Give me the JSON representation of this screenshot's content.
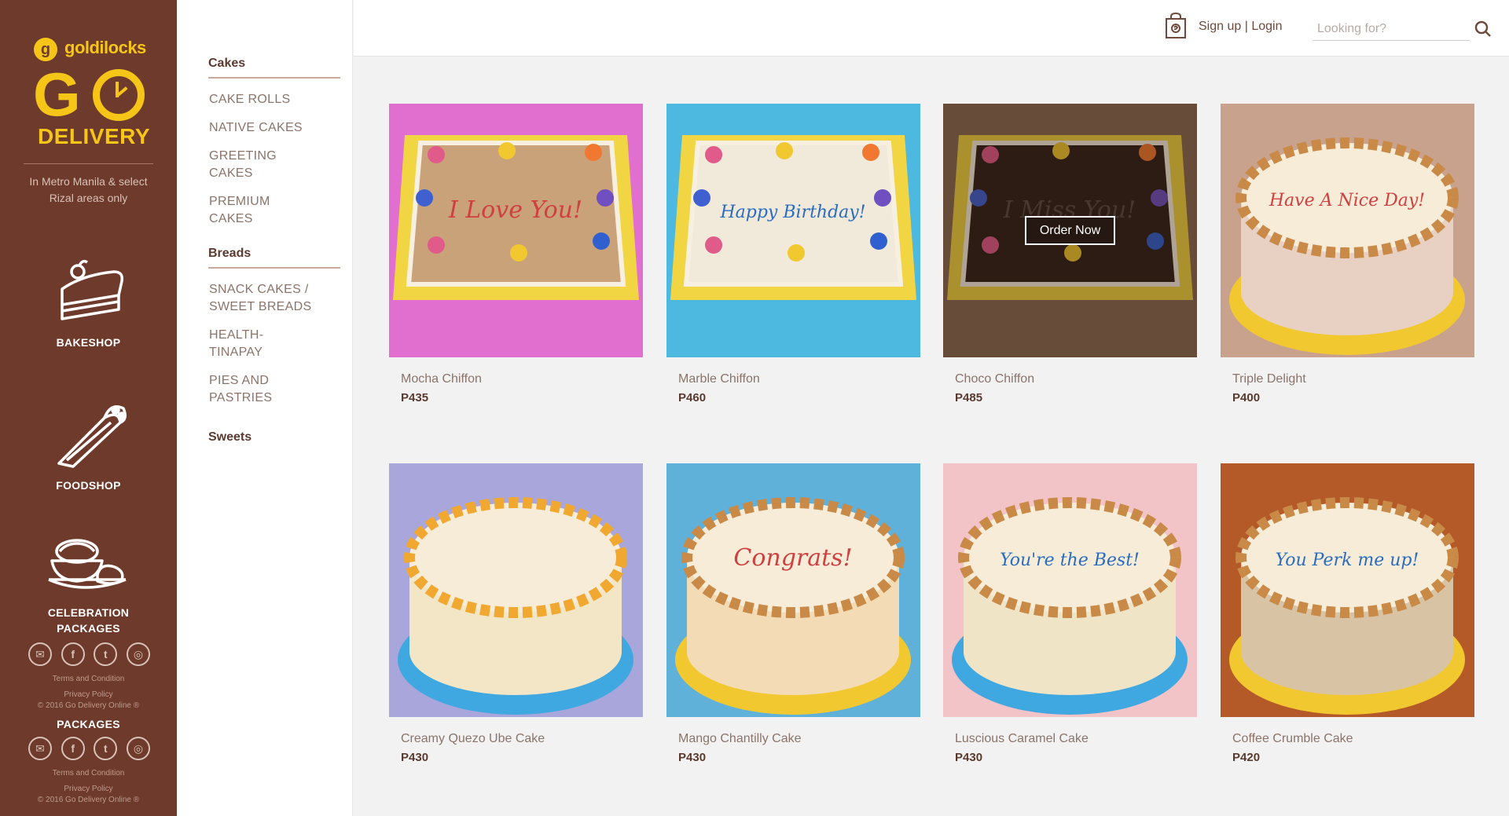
{
  "sidebar": {
    "brand_small": "goldilocks",
    "brand_mark": "g",
    "brand_go": "G",
    "brand_delivery": "DELIVERY",
    "area_note": "In Metro Manila & select Rizal areas only",
    "nav": [
      {
        "label": "BAKESHOP",
        "icon": "cake-slice-icon"
      },
      {
        "label": "FOODSHOP",
        "icon": "wrap-icon"
      },
      {
        "label": "CELEBRATION PACKAGES",
        "icon": "food-platter-icon"
      }
    ],
    "duplicate_label": "PACKAGES",
    "social_icons": [
      "mail-icon",
      "facebook-icon",
      "twitter-icon",
      "instagram-icon"
    ],
    "social_glyphs": [
      "✉",
      "f",
      "t",
      "◎"
    ],
    "footer": {
      "terms": "Terms and Condition",
      "privacy": "Privacy Policy",
      "copyright": "© 2016 Go Delivery Online ®"
    }
  },
  "categories": {
    "cakes_title": "Cakes",
    "cakes": [
      "CAKE ROLLS",
      "NATIVE CAKES",
      "GREETING CAKES",
      "PREMIUM CAKES"
    ],
    "breads_title": "Breads",
    "breads": [
      "SNACK CAKES / SWEET BREADS",
      "HEALTH-TINAPAY",
      "PIES AND PASTRIES"
    ],
    "sweets_title": "Sweets"
  },
  "header": {
    "auth_signup": "Sign up",
    "auth_sep": "|",
    "auth_login": "Login",
    "search_placeholder": "Looking for?"
  },
  "products": [
    {
      "name": "Mocha Chiffon",
      "price": "P435",
      "text": "I Love You!",
      "bg": "#e06fcf",
      "cake": "#c9a27a"
    },
    {
      "name": "Marble Chiffon",
      "price": "P460",
      "text": "Happy Birthday!",
      "bg": "#4db8e0",
      "cake": "#f1eadb"
    },
    {
      "name": "Choco Chiffon",
      "price": "P485",
      "text": "I Miss You!",
      "bg": "#8a6a55",
      "cake": "#2e211b",
      "hover": true,
      "order_label": "Order Now"
    },
    {
      "name": "Triple Delight",
      "price": "P400",
      "text": "Have A Nice Day!",
      "bg": "#c9a28d",
      "cake": "#e8d1c3"
    },
    {
      "name": "Creamy Quezo Ube Cake",
      "price": "P430",
      "text": "",
      "bg": "#a9a6dc",
      "cake": "#f3e6c7"
    },
    {
      "name": "Mango Chantilly Cake",
      "price": "P430",
      "text": "Congrats!",
      "bg": "#5fb1d9",
      "cake": "#f3dcb5"
    },
    {
      "name": "Luscious Caramel Cake",
      "price": "P430",
      "text": "You're the Best!",
      "bg": "#f2c4c8",
      "cake": "#f0e4c6"
    },
    {
      "name": "Coffee Crumble Cake",
      "price": "P420",
      "text": "You Perk me up!",
      "bg": "#b45a28",
      "cake": "#d9c3a5"
    }
  ],
  "colors": {
    "brand": "#6e3a2b",
    "accent": "#f5c518"
  }
}
